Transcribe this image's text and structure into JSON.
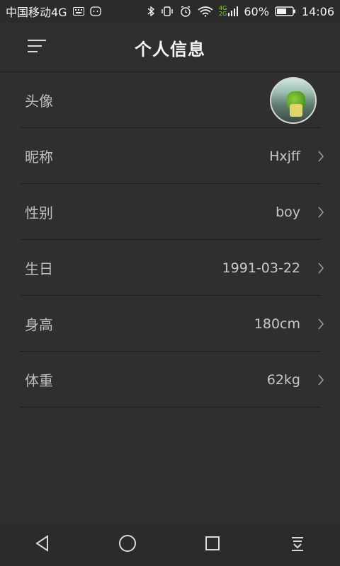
{
  "status_bar": {
    "carrier": "中国移动4G",
    "battery_percent": "60%",
    "time": "14:06",
    "network_labels": [
      "4G",
      "2G"
    ],
    "icons": [
      "keyboard-icon",
      "android-icon",
      "bluetooth-icon",
      "vibrate-icon",
      "alarm-icon",
      "wifi-icon",
      "signal-icon",
      "battery-icon"
    ]
  },
  "header": {
    "title": "个人信息",
    "menu_icon": "menu-icon"
  },
  "profile": {
    "rows": [
      {
        "key": "avatar",
        "label": "头像",
        "value": ""
      },
      {
        "key": "nickname",
        "label": "昵称",
        "value": "Hxjff"
      },
      {
        "key": "gender",
        "label": "性别",
        "value": "boy"
      },
      {
        "key": "birthday",
        "label": "生日",
        "value": "1991-03-22"
      },
      {
        "key": "height",
        "label": "身高",
        "value": "180cm"
      },
      {
        "key": "weight",
        "label": "体重",
        "value": "62kg"
      }
    ]
  },
  "nav": {
    "buttons": [
      "back-icon",
      "home-icon",
      "recents-icon",
      "notification-pull-icon"
    ]
  },
  "colors": {
    "background": "#2f2f2f",
    "divider": "#1e1e1e",
    "label": "#bfbfbf",
    "value": "#c8c8c8",
    "title": "#f4f4f4"
  }
}
